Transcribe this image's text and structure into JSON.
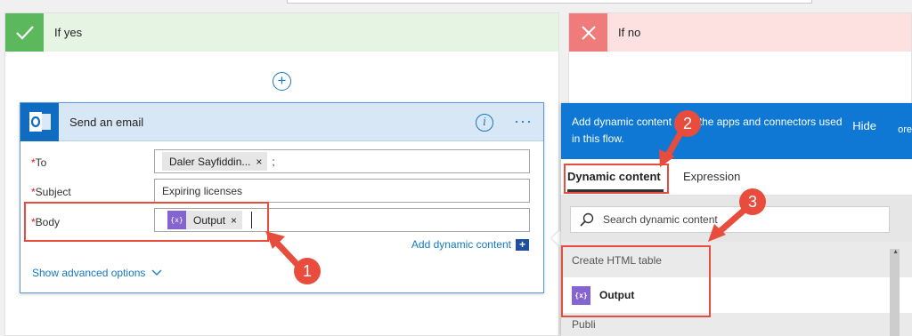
{
  "condition": {
    "yes_label": "If yes",
    "no_label": "If no"
  },
  "action": {
    "title": "Send an email",
    "to_label": "To",
    "to_token": "Daler Sayfiddin...",
    "to_separator": ";",
    "subject_label": "Subject",
    "subject_value": "Expiring licenses",
    "body_label": "Body",
    "body_token": "Output",
    "add_dynamic": "Add dynamic content",
    "show_advanced": "Show advanced options",
    "required_mark": "*"
  },
  "dynamic_panel": {
    "header_text": "Add dynamic content from the apps and connectors used in this flow.",
    "hide_label": "Hide",
    "clipped_text": "ore",
    "tabs": [
      "Dynamic content",
      "Expression"
    ],
    "search_placeholder": "Search dynamic content",
    "section_title": "Create HTML table",
    "item_label": "Output",
    "next_section": "Publi"
  },
  "callouts": [
    "1",
    "2",
    "3"
  ],
  "colors": {
    "accent": "#0f78d4",
    "callout": "#e74c3c",
    "yes": "#5cb85c",
    "no": "#ef7b7b",
    "token_icon": "#8564d1"
  },
  "icons": {
    "yes": "checkmark-icon",
    "no": "close-icon",
    "add_step": "plus-circle-icon",
    "app": "outlook-icon",
    "info": "info-icon",
    "menu": "more-icon",
    "variable": "variable-icon",
    "search": "search-icon",
    "expand": "chevron-down-icon"
  }
}
